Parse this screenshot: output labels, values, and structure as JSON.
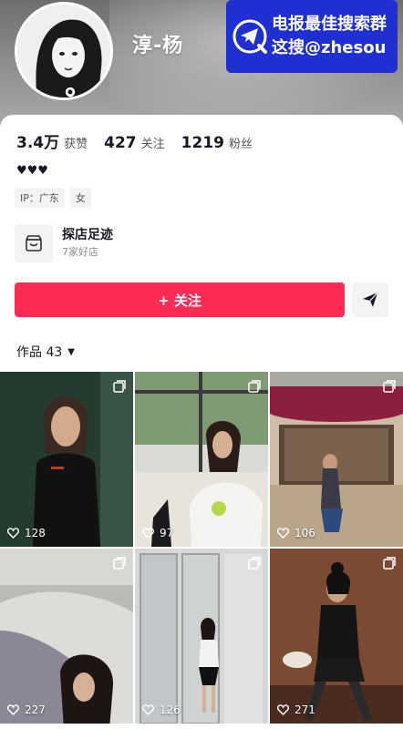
{
  "profile": {
    "nickname": "淳-杨",
    "stats": [
      {
        "value": "3.4万",
        "label": "获赞"
      },
      {
        "value": "427",
        "label": "关注"
      },
      {
        "value": "1219",
        "label": "粉丝"
      }
    ],
    "signature": "♥♥♥",
    "tags": [
      "IP：广东",
      "女"
    ]
  },
  "watermark": {
    "line1": "电报最佳搜索群",
    "line2": "这搜@zhesou"
  },
  "shop": {
    "title": "探店足迹",
    "subtitle": "7家好店"
  },
  "actions": {
    "follow_label": "+ 关注"
  },
  "works": {
    "label": "作品 43",
    "items": [
      {
        "likes": "128"
      },
      {
        "likes": "97"
      },
      {
        "likes": "106"
      },
      {
        "likes": "227"
      },
      {
        "likes": "126"
      },
      {
        "likes": "271"
      }
    ]
  },
  "colors": {
    "accent": "#fe2c55",
    "watermark_bg": "#1f2fd1"
  }
}
